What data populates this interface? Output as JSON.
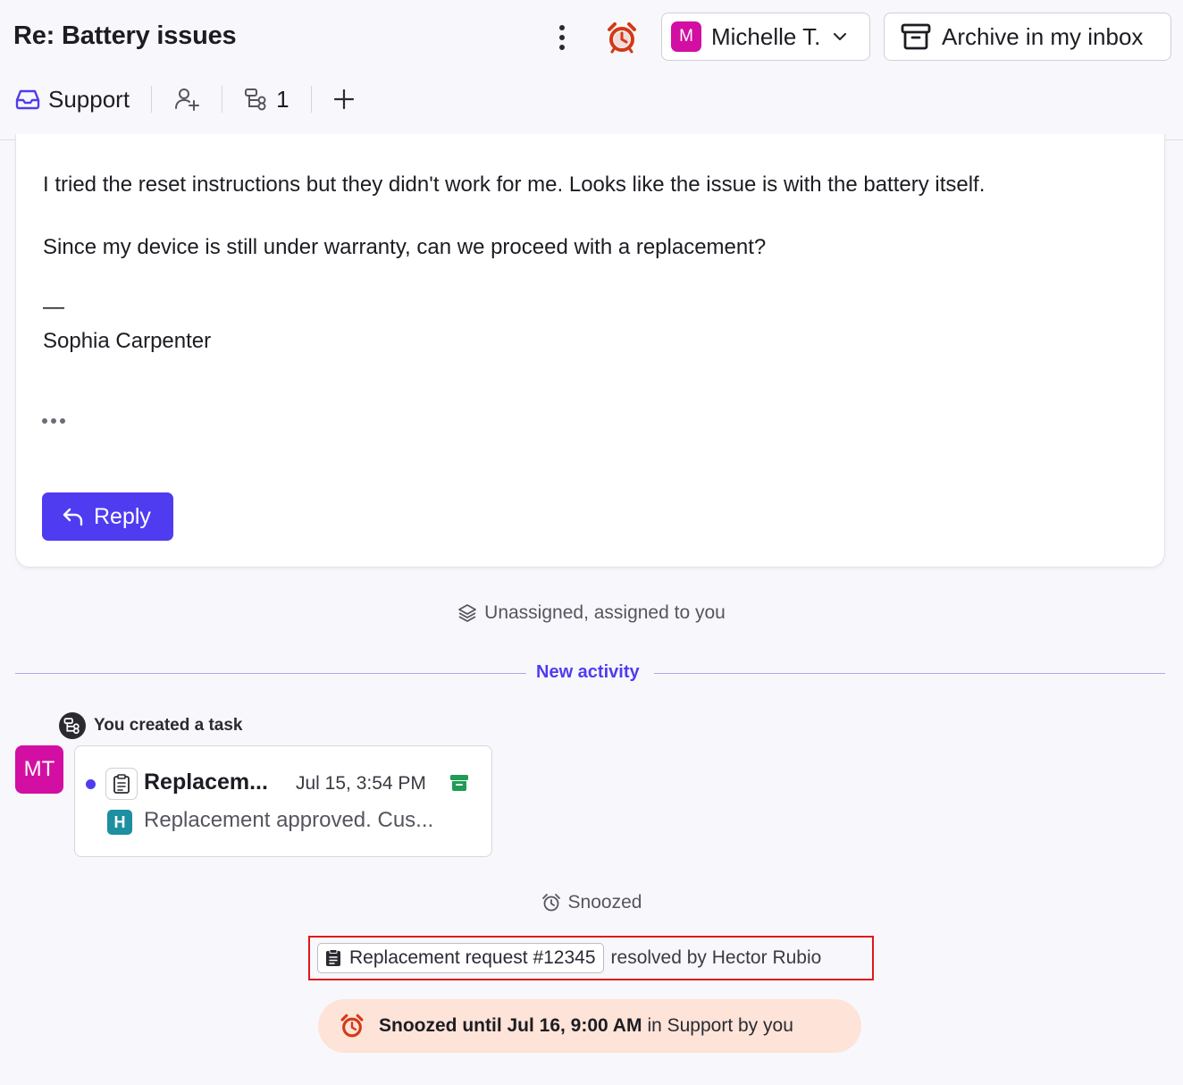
{
  "header": {
    "title": "Re: Battery issues",
    "assignee": {
      "initial": "M",
      "name": "Michelle T."
    },
    "archive_label": "Archive in my inbox"
  },
  "subbar": {
    "inbox_label": "Support",
    "task_count": "1"
  },
  "message": {
    "paragraph1": "I tried the reset instructions but they didn't work for me. Looks like the issue is with the battery itself.",
    "paragraph2": "Since my device is still under warranty, can we proceed with a replacement?",
    "signature_dash": "—",
    "signature_name": "Sophia Carpenter",
    "reply_label": "Reply"
  },
  "activity": {
    "assignment_text": "Unassigned, assigned to you",
    "new_activity_label": "New activity",
    "created_text": "You created a task",
    "creator_initials": "MT",
    "task": {
      "title": "Replacem...",
      "date": "Jul 15, 3:54 PM",
      "author_initial": "H",
      "preview": "Replacement approved. Cus..."
    },
    "snoozed_text": "Snoozed",
    "resolved": {
      "chip_label": "Replacement request #12345",
      "text": "resolved by Hector Rubio"
    },
    "snooze_banner": {
      "bold": "Snoozed until Jul 16, 9:00 AM",
      "rest": "in Support by you"
    }
  },
  "colors": {
    "accent": "#4f3cf0",
    "avatar_pink": "#d20fa2",
    "alarm_red": "#d23a16",
    "archive_green": "#1f9d55",
    "snooze_bg": "#fde3d8",
    "highlight_red": "#e01818"
  }
}
